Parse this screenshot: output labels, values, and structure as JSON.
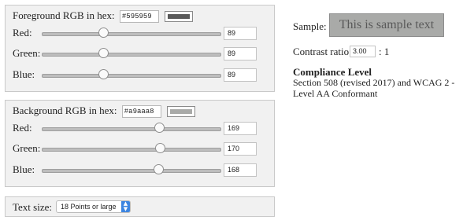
{
  "foreground": {
    "title": "Foreground RGB in hex:",
    "hex": "#595959",
    "swatch_color": "#595959",
    "channels": [
      {
        "label": "Red:",
        "value": "89",
        "fraction": 0.349
      },
      {
        "label": "Green:",
        "value": "89",
        "fraction": 0.349
      },
      {
        "label": "Blue:",
        "value": "89",
        "fraction": 0.349
      }
    ]
  },
  "background": {
    "title": "Background RGB in hex:",
    "hex": "#a9aaa8",
    "swatch_color": "#a9aaa8",
    "channels": [
      {
        "label": "Red:",
        "value": "169",
        "fraction": 0.663
      },
      {
        "label": "Green:",
        "value": "170",
        "fraction": 0.667
      },
      {
        "label": "Blue:",
        "value": "168",
        "fraction": 0.659
      }
    ]
  },
  "text_size": {
    "label": "Text size:",
    "selected": "18 Points or large"
  },
  "sample": {
    "label": "Sample:",
    "text": "This is sample text"
  },
  "contrast": {
    "label": "Contrast ratio",
    "value": "3.00",
    "suffix": ": 1"
  },
  "compliance": {
    "heading": "Compliance Level",
    "text": "Section 508 (revised 2017) and WCAG 2 - Level AA Conformant"
  }
}
